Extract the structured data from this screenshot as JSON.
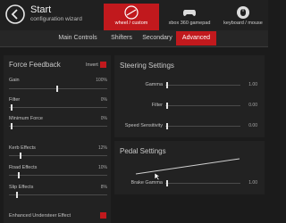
{
  "app": {
    "title": "Start",
    "subtitle": "configuration wizard"
  },
  "modes": [
    {
      "label": "wheel / custom",
      "icon": "wheel-icon"
    },
    {
      "label": "xbox 360 gamepad",
      "icon": "gamepad-icon"
    },
    {
      "label": "keyboard / mouse",
      "icon": "keyboard-mouse-icon"
    }
  ],
  "tabs": [
    "Main Controls",
    "Shifters",
    "Secondary",
    "Advanced"
  ],
  "active_tab": "Advanced",
  "force_feedback": {
    "title": "Force Feedback",
    "invert_label": "Invert",
    "invert_checked": true,
    "gain": {
      "label": "Gain",
      "value": "100%",
      "level": 0.4
    },
    "filter": {
      "label": "Filter",
      "value": "0%",
      "level": 0.03
    },
    "minimum_force": {
      "label": "Minimum Force",
      "value": "0%",
      "level": 0.03
    },
    "kerb_effects": {
      "label": "Kerb Effects",
      "value": "12%",
      "level": 0.12
    },
    "road_effects": {
      "label": "Road Effects",
      "value": "10%",
      "level": 0.1
    },
    "slip_effects": {
      "label": "Slip Effects",
      "value": "8%",
      "level": 0.08
    },
    "understeer": {
      "label": "Enhanced Understeer Effect",
      "checked": true
    }
  },
  "steering": {
    "title": "Steering Settings",
    "gamma": {
      "label": "Gamma",
      "value": "1.00",
      "level": 0.02
    },
    "filter": {
      "label": "Filter",
      "value": "0.00",
      "level": 0.02
    },
    "speed_sensitivity": {
      "label": "Speed Sensitivity",
      "value": "0.00",
      "level": 0.02
    }
  },
  "pedal": {
    "title": "Pedal Settings",
    "brake_gamma": {
      "label": "Brake Gamma",
      "value": "1.00",
      "level": 0.02
    }
  },
  "colors": {
    "accent": "#c1191d",
    "background": "#1b1b1b",
    "panel": "#222222"
  }
}
